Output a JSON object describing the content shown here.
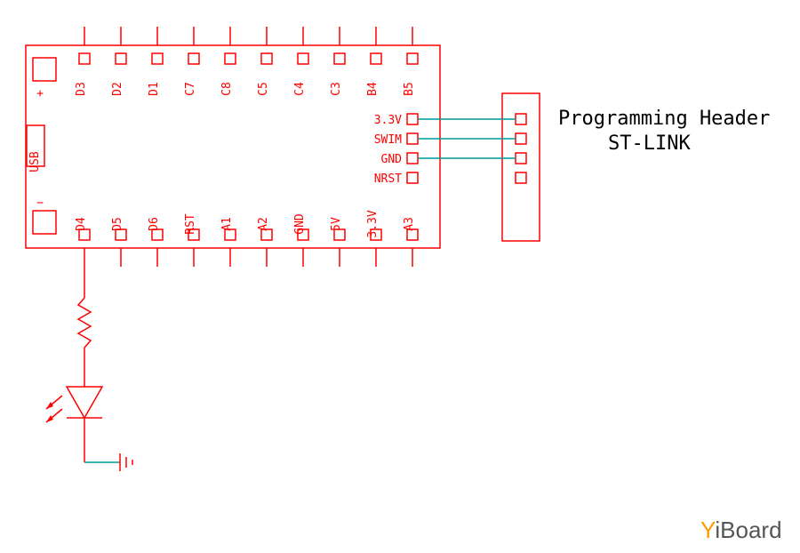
{
  "board": {
    "top_pins": [
      "D3",
      "D2",
      "D1",
      "C7",
      "C8",
      "C5",
      "C4",
      "C3",
      "B4",
      "B5"
    ],
    "bottom_pins": [
      "D4",
      "D5",
      "D6",
      "RST",
      "A1",
      "A2",
      "GND",
      "5V",
      "3.3V",
      "A3"
    ],
    "prog_pins": [
      "3.3V",
      "SWIM",
      "GND",
      "NRST"
    ],
    "usb_label": "USB",
    "plus": "+",
    "minus": "−"
  },
  "header": {
    "title_line1": "Programming Header",
    "title_line2": "ST-LINK"
  },
  "logo": {
    "y": "Y",
    "rest": "iBoard"
  }
}
